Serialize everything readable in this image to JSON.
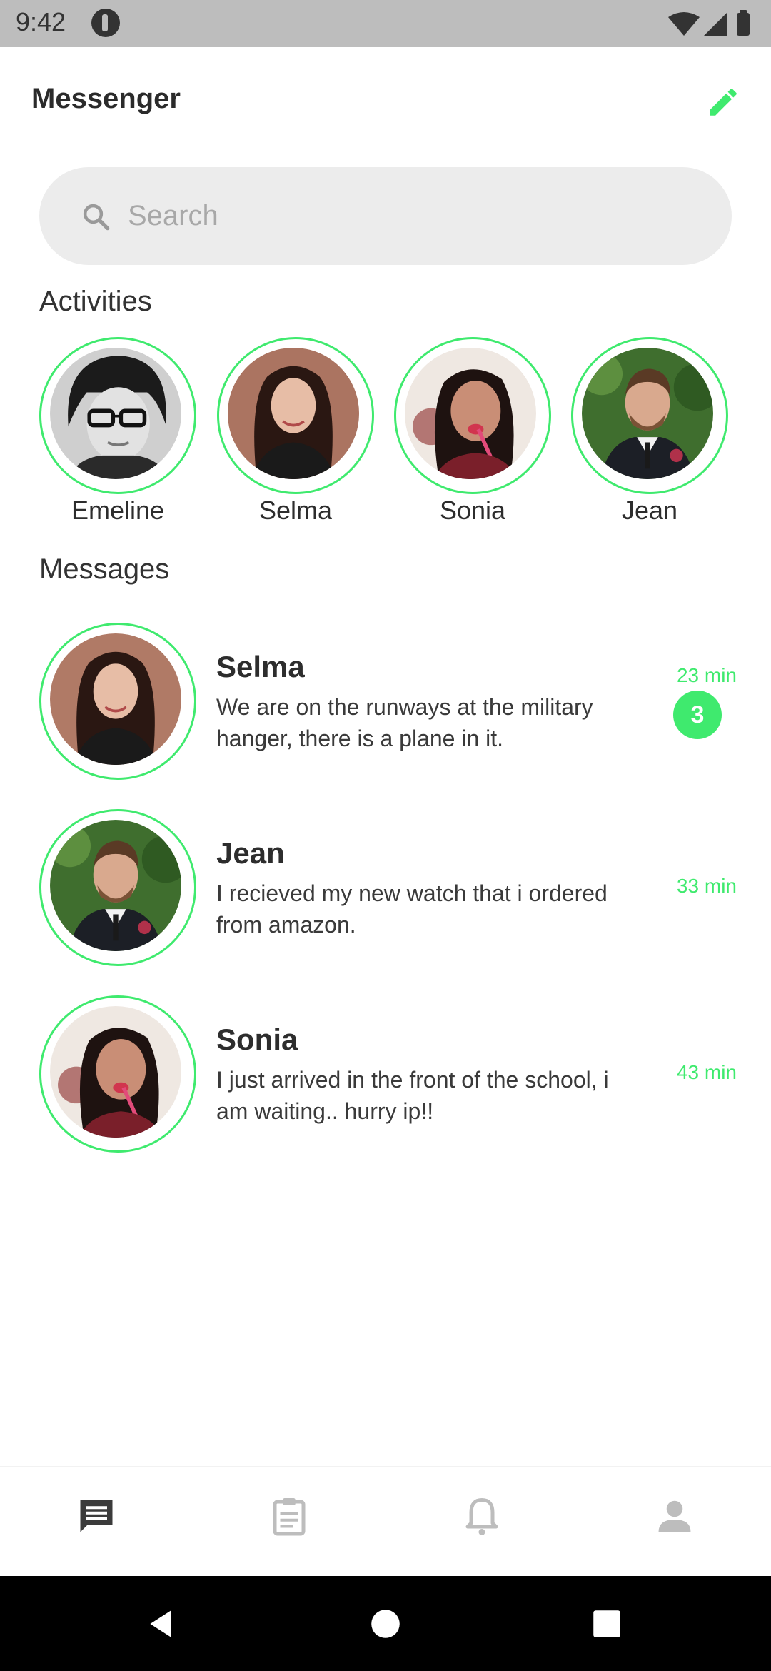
{
  "status_bar": {
    "time": "9:42"
  },
  "header": {
    "title": "Messenger",
    "compose_icon": "pencil-icon"
  },
  "search": {
    "placeholder": "Search",
    "icon": "search-icon"
  },
  "activities": {
    "title": "Activities",
    "items": [
      {
        "name": "Emeline"
      },
      {
        "name": "Selma"
      },
      {
        "name": "Sonia"
      },
      {
        "name": "Jean"
      }
    ]
  },
  "messages": {
    "title": "Messages",
    "items": [
      {
        "name": "Selma",
        "text": "We are on the runways at the military hanger, there is a plane in it.",
        "time": "23 min",
        "unread": "3"
      },
      {
        "name": "Jean",
        "text": "I recieved my new watch that i ordered from amazon.",
        "time": "33 min"
      },
      {
        "name": "Sonia",
        "text": "I just arrived in the front of the school, i am waiting.. hurry ip!!",
        "time": "43 min"
      }
    ]
  },
  "bottom_nav": {
    "items": [
      {
        "icon": "chat-icon",
        "active": true
      },
      {
        "icon": "clipboard-icon",
        "active": false
      },
      {
        "icon": "bell-icon",
        "active": false
      },
      {
        "icon": "person-icon",
        "active": false
      }
    ]
  },
  "colors": {
    "accent": "#3fea6e",
    "search_bg": "#ececec",
    "status_bar": "#bdbdbd"
  }
}
